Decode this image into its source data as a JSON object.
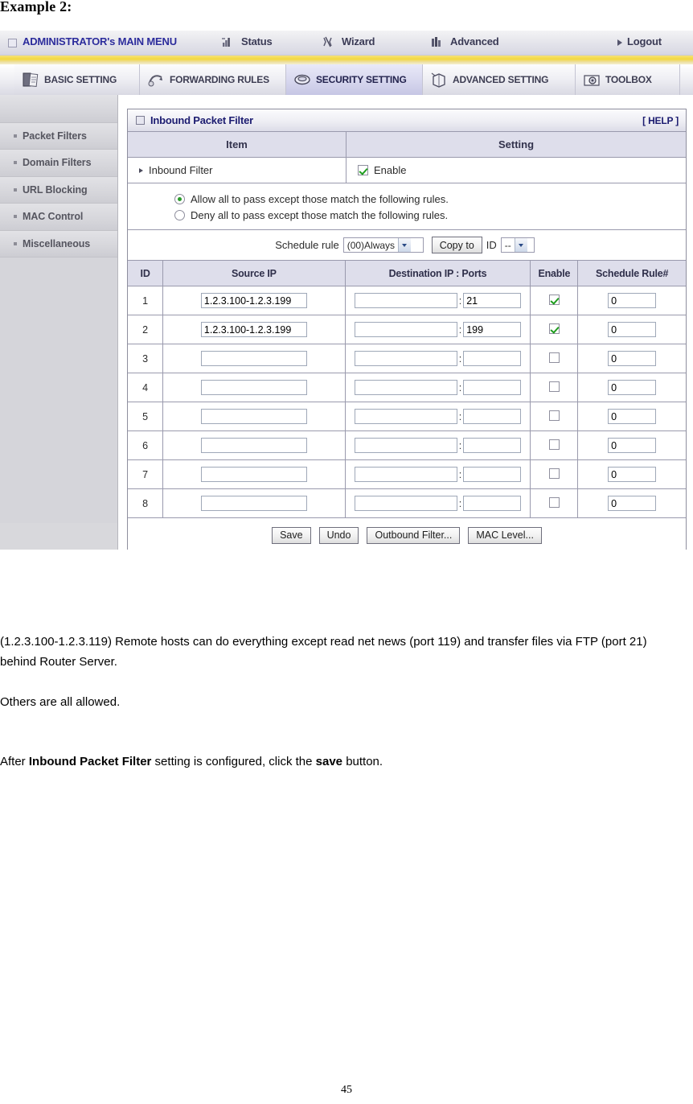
{
  "document": {
    "example_heading": "Example 2:",
    "paragraph_1": "(1.2.3.100-1.2.3.119) Remote hosts can do everything except read net news (port 119) and transfer files via FTP (port 21) behind Router Server.",
    "paragraph_2": "Others are all allowed.",
    "paragraph_3_prefix": "After ",
    "paragraph_3_bold1": "Inbound Packet Filter",
    "paragraph_3_middle": " setting is configured, click the ",
    "paragraph_3_bold2": "save",
    "paragraph_3_suffix": " button.",
    "page_number": "45"
  },
  "router_ui": {
    "top_menu": {
      "brand": "ADMINISTRATOR's MAIN MENU",
      "status": "Status",
      "wizard": "Wizard",
      "advanced": "Advanced",
      "logout": "Logout"
    },
    "tabs": [
      {
        "label": "BASIC SETTING",
        "active": false
      },
      {
        "label": "FORWARDING RULES",
        "active": false
      },
      {
        "label": "SECURITY SETTING",
        "active": true
      },
      {
        "label": "ADVANCED SETTING",
        "active": false
      },
      {
        "label": "TOOLBOX",
        "active": false
      }
    ],
    "sidebar": {
      "items": [
        {
          "label": "Packet Filters"
        },
        {
          "label": "Domain Filters"
        },
        {
          "label": "URL Blocking"
        },
        {
          "label": "MAC Control"
        },
        {
          "label": "Miscellaneous"
        }
      ]
    },
    "panel": {
      "title": "Inbound Packet Filter",
      "help": "[ HELP ]",
      "header": {
        "item": "Item",
        "setting": "Setting"
      },
      "inbound_filter": {
        "label": "Inbound Filter",
        "enable_label": "Enable",
        "enabled": true
      },
      "policy": {
        "allow": {
          "label": "Allow all to pass except those match the following rules.",
          "selected": true
        },
        "deny": {
          "label": "Deny all to pass except those match the following rules.",
          "selected": false
        }
      },
      "schedule": {
        "label": "Schedule rule",
        "rule_value": "(00)Always",
        "copy_to_button": "Copy to",
        "id_label": "ID",
        "id_value": "--"
      },
      "table": {
        "columns": [
          "ID",
          "Source IP",
          "Destination IP : Ports",
          "Enable",
          "Schedule Rule#"
        ],
        "rows": [
          {
            "id": "1",
            "source_ip": "1.2.3.100-1.2.3.199",
            "dest_ip": "",
            "port": "21",
            "enable": true,
            "schedule_rule": "0"
          },
          {
            "id": "2",
            "source_ip": "1.2.3.100-1.2.3.199",
            "dest_ip": "",
            "port": "199",
            "enable": true,
            "schedule_rule": "0"
          },
          {
            "id": "3",
            "source_ip": "",
            "dest_ip": "",
            "port": "",
            "enable": false,
            "schedule_rule": "0"
          },
          {
            "id": "4",
            "source_ip": "",
            "dest_ip": "",
            "port": "",
            "enable": false,
            "schedule_rule": "0"
          },
          {
            "id": "5",
            "source_ip": "",
            "dest_ip": "",
            "port": "",
            "enable": false,
            "schedule_rule": "0"
          },
          {
            "id": "6",
            "source_ip": "",
            "dest_ip": "",
            "port": "",
            "enable": false,
            "schedule_rule": "0"
          },
          {
            "id": "7",
            "source_ip": "",
            "dest_ip": "",
            "port": "",
            "enable": false,
            "schedule_rule": "0"
          },
          {
            "id": "8",
            "source_ip": "",
            "dest_ip": "",
            "port": "",
            "enable": false,
            "schedule_rule": "0"
          }
        ]
      },
      "footer_buttons": [
        "Save",
        "Undo",
        "Outbound Filter...",
        "MAC Level..."
      ]
    },
    "colors": {
      "accent_yellow": "#f3d83f",
      "title_blue": "#1c1c70",
      "header_lavender": "#dedeeb",
      "active_tab": "#d7d7ee",
      "sidebar_gray": "#d6d6db",
      "check_green": "#1f9d1f"
    }
  }
}
